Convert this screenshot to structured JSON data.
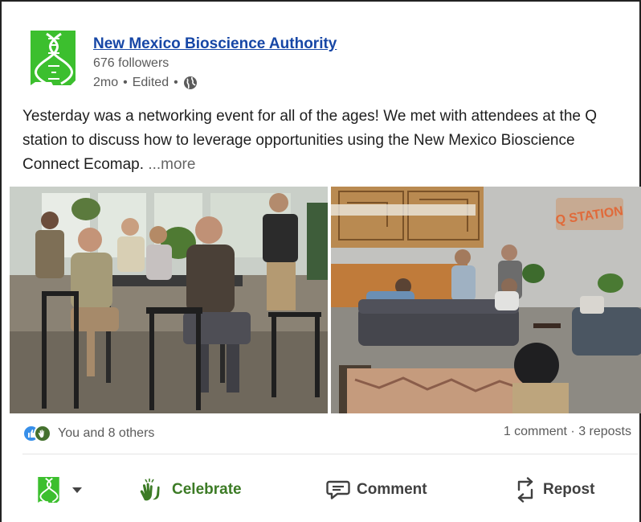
{
  "post": {
    "author": {
      "name": "New Mexico Bioscience Authority",
      "followers": "676 followers",
      "age": "2mo",
      "edited": "Edited",
      "separator": "•"
    },
    "text": "Yesterday was a networking event for all of the ages! We met with attendees at the Q station to discuss how to leverage opportunities using the New Mexico Bioscience Connect Ecomap.",
    "more_label": "...more",
    "photos": {
      "right_sign": "Q STATION"
    },
    "social": {
      "reactions_label": "You and 8 others",
      "comments": "1 comment",
      "dot": "·",
      "reposts": "3 reposts"
    },
    "actions": {
      "celebrate": "Celebrate",
      "comment": "Comment",
      "repost": "Repost"
    },
    "colors": {
      "brand_green": "#3cbf2e",
      "link_blue": "#1747a6",
      "celebrate_green": "#3c7b25"
    },
    "icons": {
      "logo": "dna-new-mexico-logo-icon",
      "globe": "globe-icon",
      "like": "like-icon",
      "celebrate": "clap-icon",
      "comment": "comment-icon",
      "repost": "repost-icon"
    }
  }
}
